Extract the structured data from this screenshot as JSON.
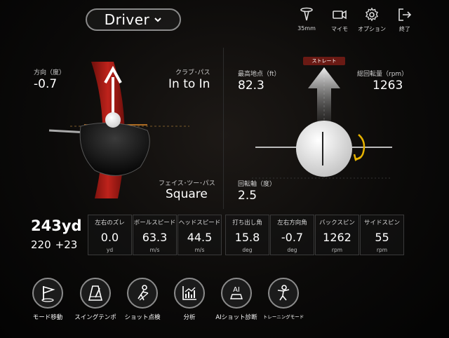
{
  "header": {
    "club": "Driver",
    "buttons": [
      {
        "label": "35mm",
        "icon": "tee-icon"
      },
      {
        "label": "マイモ",
        "icon": "video-camera-icon"
      },
      {
        "label": "オプション",
        "icon": "gear-icon"
      },
      {
        "label": "終了",
        "icon": "exit-icon"
      }
    ]
  },
  "left_panel": {
    "direction_label": "方向（度）",
    "direction_value": "-0.7",
    "club_path_label": "クラブ･パス",
    "club_path_value": "In to In",
    "face_to_path_label": "フェイス･ツー･パス",
    "face_to_path_value": "Square"
  },
  "right_panel": {
    "straight_tag": "ストレート",
    "apex_label": "最高地点（ft）",
    "apex_value": "82.3",
    "total_spin_label": "総回転量（rpm）",
    "total_spin_value": "1263",
    "spin_axis_label": "回転軸（度）",
    "spin_axis_value": "2.5"
  },
  "distance": {
    "total": "243yd",
    "carry": "220",
    "roll": "+23"
  },
  "stats": [
    {
      "label": "左右のズレ",
      "value": "0.0",
      "unit": "yd"
    },
    {
      "label": "ボールスピード",
      "value": "63.3",
      "unit": "m/s"
    },
    {
      "label": "ヘッドスピード",
      "value": "44.5",
      "unit": "m/s"
    },
    {
      "label": "打ち出し角",
      "value": "15.8",
      "unit": "deg"
    },
    {
      "label": "左右方向角",
      "value": "-0.7",
      "unit": "deg"
    },
    {
      "label": "バックスピン",
      "value": "1262",
      "unit": "rpm"
    },
    {
      "label": "サイドスピン",
      "value": "55",
      "unit": "rpm"
    }
  ],
  "bottom_buttons": [
    {
      "label": "モード移動",
      "icon": "flag-icon"
    },
    {
      "label": "スイングテンポ",
      "icon": "metronome-icon"
    },
    {
      "label": "ショット点検",
      "icon": "golfer-icon"
    },
    {
      "label": "分析",
      "icon": "analysis-chart-icon"
    },
    {
      "label": "AIショット診断",
      "icon": "ai-club-icon",
      "badge": "AI"
    },
    {
      "label": "トレーニングモード",
      "icon": "training-icon"
    }
  ],
  "colors": {
    "accent_red": "#c8211b",
    "tag_red": "#6a1a14",
    "border_gray": "#8c8c8c"
  }
}
